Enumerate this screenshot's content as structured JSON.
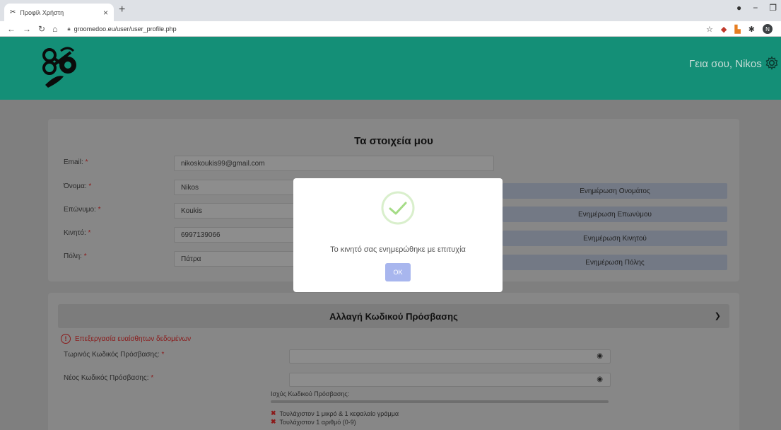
{
  "browser": {
    "tab_title": "Προφίλ Χρήστη",
    "tab_close": "×",
    "new_tab": "+",
    "url": "groomedoo.eu/user/user_profile.php",
    "profile_initial": "N"
  },
  "header": {
    "greeting": "Γεια σου, Nikos"
  },
  "profile": {
    "title": "Τα στοιχεία μου",
    "rows": [
      {
        "label": "Email: ",
        "value": "nikoskoukis99@gmail.com",
        "button": ""
      },
      {
        "label": "Όνομα: ",
        "value": "Nikos",
        "button": "Ενημέρωση Ονομάτος"
      },
      {
        "label": "Επώνυμο: ",
        "value": "Koukis",
        "button": "Ενημέρωση Επωνύμου"
      },
      {
        "label": "Κινητό: ",
        "value": "6997139066",
        "button": "Ενημέρωση Κινητού"
      },
      {
        "label": "Πόλη: ",
        "value": "Πάτρα",
        "button": "Ενημέρωση Πόλης"
      }
    ],
    "required_mark": "*"
  },
  "password": {
    "title": "Αλλαγή Κωδικού Πρόσβασης",
    "sensitive_note": "Επεξεργασία ευαίσθητων δεδομένων",
    "current_label": "Τωρινός Κωδικός Πρόσβασης: ",
    "new_label": "Νέος Κωδικός Πρόσβασης: ",
    "strength_label": "Ισχύς Κωδικού Πρόσβασης:",
    "rules": [
      "Τουλάχιστον 1 μικρό & 1 κεφαλαίο γράμμα",
      "Τουλάχιστον 1 αριθμό (0-9)"
    ]
  },
  "modal": {
    "message": "Το κινητό σας ενημερώθηκε με επιτυχία",
    "ok_label": "OK"
  },
  "colors": {
    "header_bg": "#148f77",
    "check": "#a5dc86",
    "ok_button": "#a8b6ee",
    "required": "#8b1a1a"
  }
}
